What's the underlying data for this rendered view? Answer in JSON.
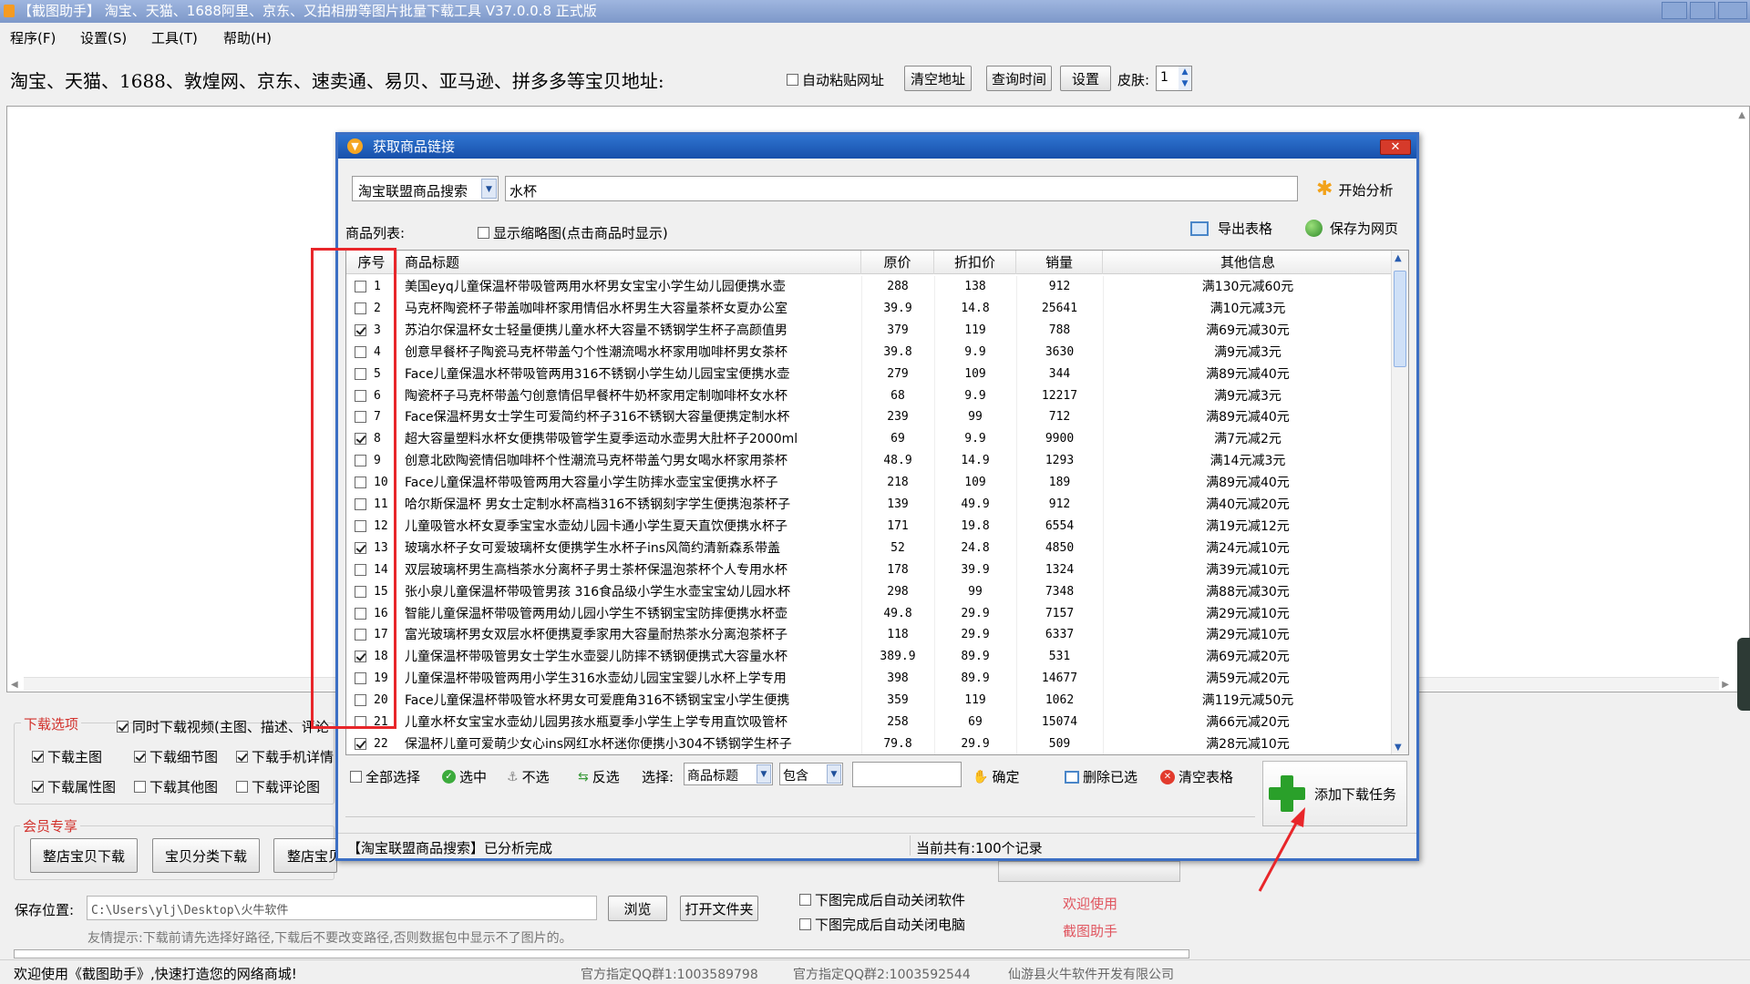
{
  "window": {
    "title": "【截图助手】 淘宝、天猫、1688阿里、京东、又拍相册等图片批量下载工具 V37.0.0.8 正式版"
  },
  "menu": [
    "程序(F)",
    "设置(S)",
    "工具(T)",
    "帮助(H)"
  ],
  "address_bar": {
    "label": "淘宝、天猫、1688、敦煌网、京东、速卖通、易贝、亚马逊、拼多多等宝贝地址:",
    "auto_paste": "自动粘贴网址",
    "clear_btn": "清空地址",
    "query_btn": "查询时间",
    "settings_btn": "设置",
    "skin_label": "皮肤:",
    "skin_value": "1"
  },
  "download_options": {
    "title": "下载选项",
    "video": "同时下载视频(主图、描述、评论",
    "main_img": "下载主图",
    "detail_img": "下载细节图",
    "mobile": "下载手机详情",
    "attr_img": "下载属性图",
    "other_img": "下载其他图",
    "review_img": "下载评论图"
  },
  "member": {
    "title": "会员专享",
    "btn1": "整店宝贝下载",
    "btn2": "宝贝分类下载",
    "btn3": "整店宝贝"
  },
  "save": {
    "label": "保存位置:",
    "path": "C:\\Users\\ylj\\Desktop\\火牛软件",
    "browse": "浏览",
    "open": "打开文件夹",
    "tip": "友情提示:下载前请先选择好路径,下载后不要改变路径,否则数据包中显示不了图片的。"
  },
  "after": {
    "close_app": "下图完成后自动关闭软件",
    "shutdown": "下图完成后自动关闭电脑",
    "welcome1": "欢迎使用",
    "welcome2": "截图助手"
  },
  "status": {
    "left": "欢迎使用《截图助手》,快速打造您的网络商城!",
    "qq1": "官方指定QQ群1:1003589798",
    "qq2": "官方指定QQ群2:1003592544",
    "company": "仙游县火牛软件开发有限公司"
  },
  "dialog": {
    "title": "获取商品链接",
    "source_select": "淘宝联盟商品搜索",
    "keyword": "水杯",
    "analyze_btn": "开始分析",
    "list_label": "商品列表:",
    "show_thumb": "显示缩略图(点击商品时显示)",
    "export_btn": "导出表格",
    "save_web_btn": "保存为网页",
    "columns": [
      "序号",
      "商品标题",
      "原价",
      "折扣价",
      "销量",
      "其他信息"
    ],
    "rows": [
      {
        "checked": false,
        "no": "1",
        "title": "美国eyq儿童保温杯带吸管两用水杯男女宝宝小学生幼儿园便携水壶",
        "price": "288",
        "disc": "138",
        "sales": "912",
        "info": "满130元减60元"
      },
      {
        "checked": false,
        "no": "2",
        "title": "马克杯陶瓷杯子带盖咖啡杯家用情侣水杯男生大容量茶杯女夏办公室",
        "price": "39.9",
        "disc": "14.8",
        "sales": "25641",
        "info": "满10元减3元"
      },
      {
        "checked": true,
        "no": "3",
        "title": "苏泊尔保温杯女士轻量便携儿童水杯大容量不锈钢学生杯子高颜值男",
        "price": "379",
        "disc": "119",
        "sales": "788",
        "info": "满69元减30元"
      },
      {
        "checked": false,
        "no": "4",
        "title": "创意早餐杯子陶瓷马克杯带盖勺个性潮流喝水杯家用咖啡杯男女茶杯",
        "price": "39.8",
        "disc": "9.9",
        "sales": "3630",
        "info": "满9元减3元"
      },
      {
        "checked": false,
        "no": "5",
        "title": "Face儿童保温水杯带吸管两用316不锈钢小学生幼儿园宝宝便携水壶",
        "price": "279",
        "disc": "109",
        "sales": "344",
        "info": "满89元减40元"
      },
      {
        "checked": false,
        "no": "6",
        "title": "陶瓷杯子马克杯带盖勺创意情侣早餐杯牛奶杯家用定制咖啡杯女水杯",
        "price": "68",
        "disc": "9.9",
        "sales": "12217",
        "info": "满9元减3元"
      },
      {
        "checked": false,
        "no": "7",
        "title": "Face保温杯男女士学生可爱简约杯子316不锈钢大容量便携定制水杯",
        "price": "239",
        "disc": "99",
        "sales": "712",
        "info": "满89元减40元"
      },
      {
        "checked": true,
        "no": "8",
        "title": "超大容量塑料水杯女便携带吸管学生夏季运动水壶男大肚杯子2000ml",
        "price": "69",
        "disc": "9.9",
        "sales": "9900",
        "info": "满7元减2元"
      },
      {
        "checked": false,
        "no": "9",
        "title": "创意北欧陶瓷情侣咖啡杯个性潮流马克杯带盖勺男女喝水杯家用茶杯",
        "price": "48.9",
        "disc": "14.9",
        "sales": "1293",
        "info": "满14元减3元"
      },
      {
        "checked": false,
        "no": "10",
        "title": "Face儿童保温杯带吸管两用大容量小学生防摔水壶宝宝便携水杯子",
        "price": "218",
        "disc": "109",
        "sales": "189",
        "info": "满89元减40元"
      },
      {
        "checked": false,
        "no": "11",
        "title": "哈尔斯保温杯 男女士定制水杯高档316不锈钢刻字学生便携泡茶杯子",
        "price": "139",
        "disc": "49.9",
        "sales": "912",
        "info": "满40元减20元"
      },
      {
        "checked": false,
        "no": "12",
        "title": "儿童吸管水杯女夏季宝宝水壶幼儿园卡通小学生夏天直饮便携水杯子",
        "price": "171",
        "disc": "19.8",
        "sales": "6554",
        "info": "满19元减12元"
      },
      {
        "checked": true,
        "no": "13",
        "title": "玻璃水杯子女可爱玻璃杯女便携学生水杯子ins风简约清新森系带盖",
        "price": "52",
        "disc": "24.8",
        "sales": "4850",
        "info": "满24元减10元"
      },
      {
        "checked": false,
        "no": "14",
        "title": "双层玻璃杯男生高档茶水分离杯子男士茶杯保温泡茶杯个人专用水杯",
        "price": "178",
        "disc": "39.9",
        "sales": "1324",
        "info": "满39元减10元"
      },
      {
        "checked": false,
        "no": "15",
        "title": "张小泉儿童保温杯带吸管男孩 316食品级小学生水壶宝宝幼儿园水杯",
        "price": "298",
        "disc": "99",
        "sales": "7348",
        "info": "满88元减30元"
      },
      {
        "checked": false,
        "no": "16",
        "title": "智能儿童保温杯带吸管两用幼儿园小学生不锈钢宝宝防摔便携水杯壶",
        "price": "49.8",
        "disc": "29.9",
        "sales": "7157",
        "info": "满29元减10元"
      },
      {
        "checked": false,
        "no": "17",
        "title": "富光玻璃杯男女双层水杯便携夏季家用大容量耐热茶水分离泡茶杯子",
        "price": "118",
        "disc": "29.9",
        "sales": "6337",
        "info": "满29元减10元"
      },
      {
        "checked": true,
        "no": "18",
        "title": "儿童保温杯带吸管男女士学生水壶婴儿防摔不锈钢便携式大容量水杯",
        "price": "389.9",
        "disc": "89.9",
        "sales": "531",
        "info": "满69元减20元"
      },
      {
        "checked": false,
        "no": "19",
        "title": "儿童保温杯带吸管两用小学生316水壶幼儿园宝宝婴儿水杯上学专用",
        "price": "398",
        "disc": "89.9",
        "sales": "14677",
        "info": "满59元减20元"
      },
      {
        "checked": false,
        "no": "20",
        "title": "Face儿童保温杯带吸管水杯男女可爱鹿角316不锈钢宝宝小学生便携",
        "price": "359",
        "disc": "119",
        "sales": "1062",
        "info": "满119元减50元"
      },
      {
        "checked": false,
        "no": "21",
        "title": "儿童水杯女宝宝水壶幼儿园男孩水瓶夏季小学生上学专用直饮吸管杯",
        "price": "258",
        "disc": "69",
        "sales": "15074",
        "info": "满66元减20元"
      },
      {
        "checked": true,
        "no": "22",
        "title": "保温杯儿童可爱萌少女心ins网红水杯迷你便携小304不锈钢学生杯子",
        "price": "79.8",
        "disc": "29.9",
        "sales": "509",
        "info": "满28元减10元"
      }
    ],
    "bottom": {
      "select_all": "全部选择",
      "select": "选中",
      "unselect": "不选",
      "invert": "反选",
      "choose_label": "选择:",
      "field": "商品标题",
      "op": "包含",
      "confirm": "确定",
      "delete_sel": "删除已选",
      "clear_table": "清空表格",
      "add_task": "添加下载任务"
    },
    "status_left": "【淘宝联盟商品搜索】已分析完成",
    "status_right": "当前共有:100个记录"
  },
  "colors": {
    "highlight_red": "#e8262a",
    "dialog_title": "#1f5fbd",
    "add_green": "#2aa02a"
  }
}
